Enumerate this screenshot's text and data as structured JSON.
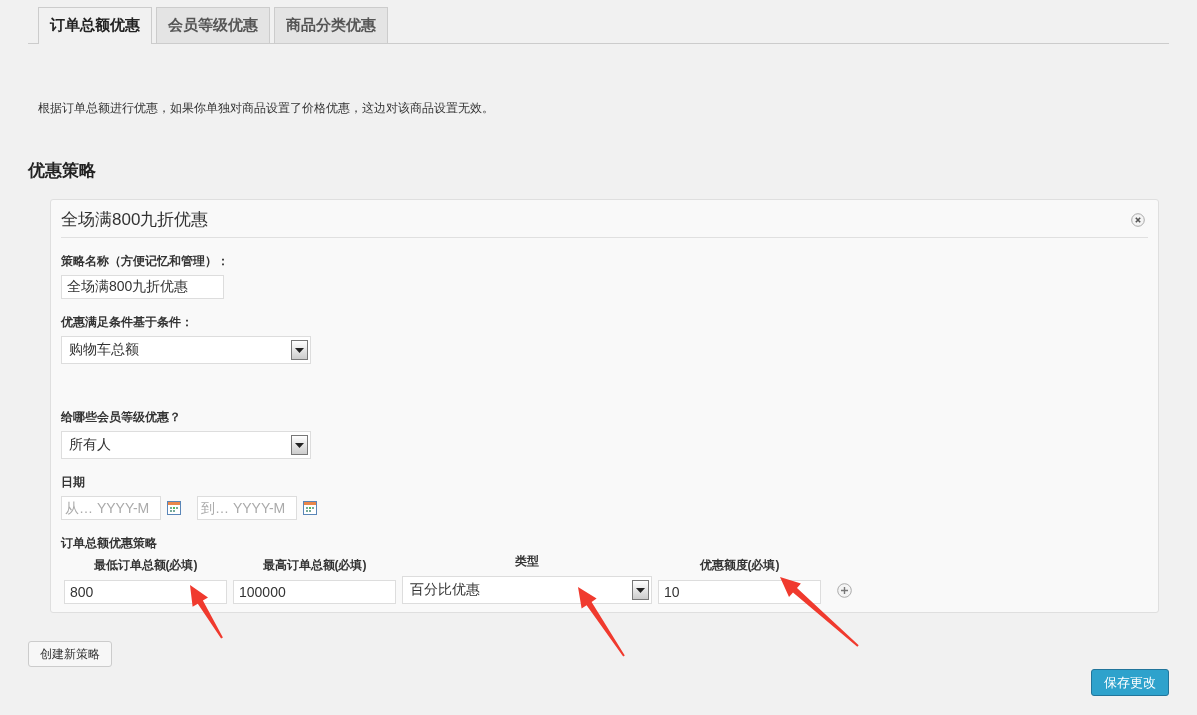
{
  "tabs": [
    {
      "label": "订单总额优惠",
      "selected": true
    },
    {
      "label": "会员等级优惠",
      "selected": false
    },
    {
      "label": "商品分类优惠",
      "selected": false
    }
  ],
  "description": "根据订单总额进行优惠，如果你单独对商品设置了价格优惠，这边对该商品设置无效。",
  "section_title": "优惠策略",
  "strategy": {
    "title": "全场满800九折优惠",
    "name_label": "策略名称（方便记忆和管理）：",
    "name_value": "全场满800九折优惠",
    "condition_label": "优惠满足条件基于条件：",
    "condition_value": "购物车总额",
    "members_label": "给哪些会员等级优惠？",
    "members_value": "所有人",
    "date_label": "日期",
    "date_from_placeholder": "从… YYYY-M",
    "date_to_placeholder": "到… YYYY-M",
    "rules_label": "订单总额优惠策略",
    "rules_columns": [
      {
        "label": "最低订单总额(必填)",
        "kind": "input",
        "value": "800"
      },
      {
        "label": "最高订单总额(必填)",
        "kind": "input",
        "value": "100000"
      },
      {
        "label": "类型",
        "kind": "select",
        "value": "百分比优惠"
      },
      {
        "label": "优惠额度(必填)",
        "kind": "input",
        "value": "10"
      }
    ]
  },
  "new_button": "创建新策略",
  "save_button": "保存更改"
}
